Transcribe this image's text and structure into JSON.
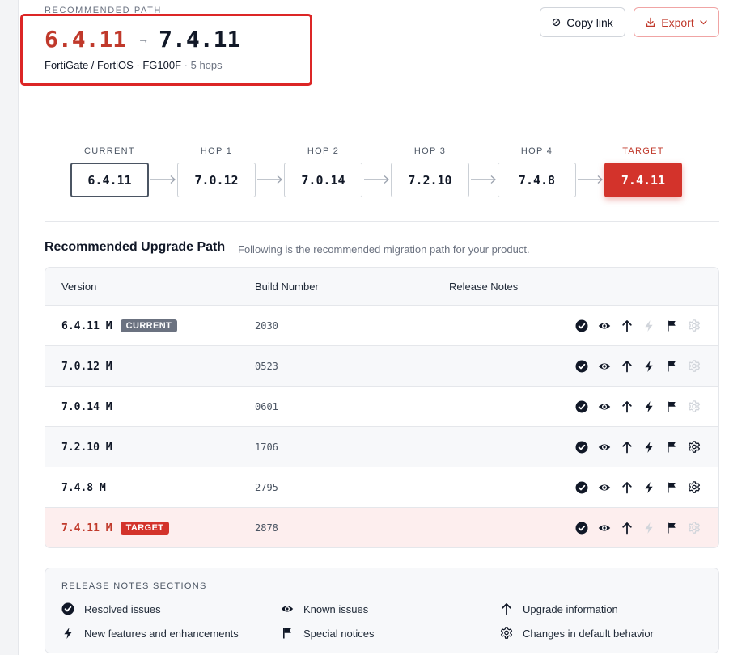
{
  "header": {
    "eyebrow": "RECOMMENDED PATH",
    "from_version": "6.4.11",
    "arrow": "→",
    "to_version": "7.4.11",
    "product": "FortiGate / FortiOS · FG100F",
    "hops": " · 5 hops"
  },
  "toolbar": {
    "copy_label": "Copy link",
    "export_label": "Export"
  },
  "hop_path": [
    {
      "label": "CURRENT",
      "version": "6.4.11",
      "kind": "current"
    },
    {
      "label": "HOP 1",
      "version": "7.0.12",
      "kind": "hop"
    },
    {
      "label": "HOP 2",
      "version": "7.0.14",
      "kind": "hop"
    },
    {
      "label": "HOP 3",
      "version": "7.2.10",
      "kind": "hop"
    },
    {
      "label": "HOP 4",
      "version": "7.4.8",
      "kind": "hop"
    },
    {
      "label": "TARGET",
      "version": "7.4.11",
      "kind": "target"
    }
  ],
  "upgrade_section": {
    "title": "Recommended Upgrade Path",
    "subtitle": "Following is the recommended migration path for your product.",
    "columns": [
      "Version",
      "Build Number",
      "Release Notes"
    ],
    "rows": [
      {
        "version": "6.4.11 M",
        "badge": "CURRENT",
        "badge_kind": "current",
        "build": "2030",
        "notes": {
          "resolved": true,
          "known": true,
          "upgrade": true,
          "features": false,
          "special": true,
          "defaults": false
        }
      },
      {
        "version": "7.0.12 M",
        "badge": "",
        "badge_kind": "",
        "build": "0523",
        "notes": {
          "resolved": true,
          "known": true,
          "upgrade": true,
          "features": true,
          "special": true,
          "defaults": false
        }
      },
      {
        "version": "7.0.14 M",
        "badge": "",
        "badge_kind": "",
        "build": "0601",
        "notes": {
          "resolved": true,
          "known": true,
          "upgrade": true,
          "features": true,
          "special": true,
          "defaults": false
        }
      },
      {
        "version": "7.2.10 M",
        "badge": "",
        "badge_kind": "",
        "build": "1706",
        "notes": {
          "resolved": true,
          "known": true,
          "upgrade": true,
          "features": true,
          "special": true,
          "defaults": true
        }
      },
      {
        "version": "7.4.8 M",
        "badge": "",
        "badge_kind": "",
        "build": "2795",
        "notes": {
          "resolved": true,
          "known": true,
          "upgrade": true,
          "features": true,
          "special": true,
          "defaults": true
        }
      },
      {
        "version": "7.4.11 M",
        "badge": "TARGET",
        "badge_kind": "target",
        "build": "2878",
        "notes": {
          "resolved": true,
          "known": true,
          "upgrade": true,
          "features": false,
          "special": true,
          "defaults": false
        }
      }
    ]
  },
  "legend": {
    "title": "RELEASE NOTES SECTIONS",
    "items": [
      {
        "icon": "check-circle-icon",
        "label": "Resolved issues"
      },
      {
        "icon": "eye-icon",
        "label": "Known issues"
      },
      {
        "icon": "arrow-up-icon",
        "label": "Upgrade information"
      },
      {
        "icon": "bolt-icon",
        "label": "New features and enhancements"
      },
      {
        "icon": "flag-icon",
        "label": "Special notices"
      },
      {
        "icon": "gear-icon",
        "label": "Changes in default behavior"
      }
    ]
  },
  "colors": {
    "accent": "#d3332b",
    "icon_active": "#111827",
    "icon_inactive": "#d1d5db"
  }
}
